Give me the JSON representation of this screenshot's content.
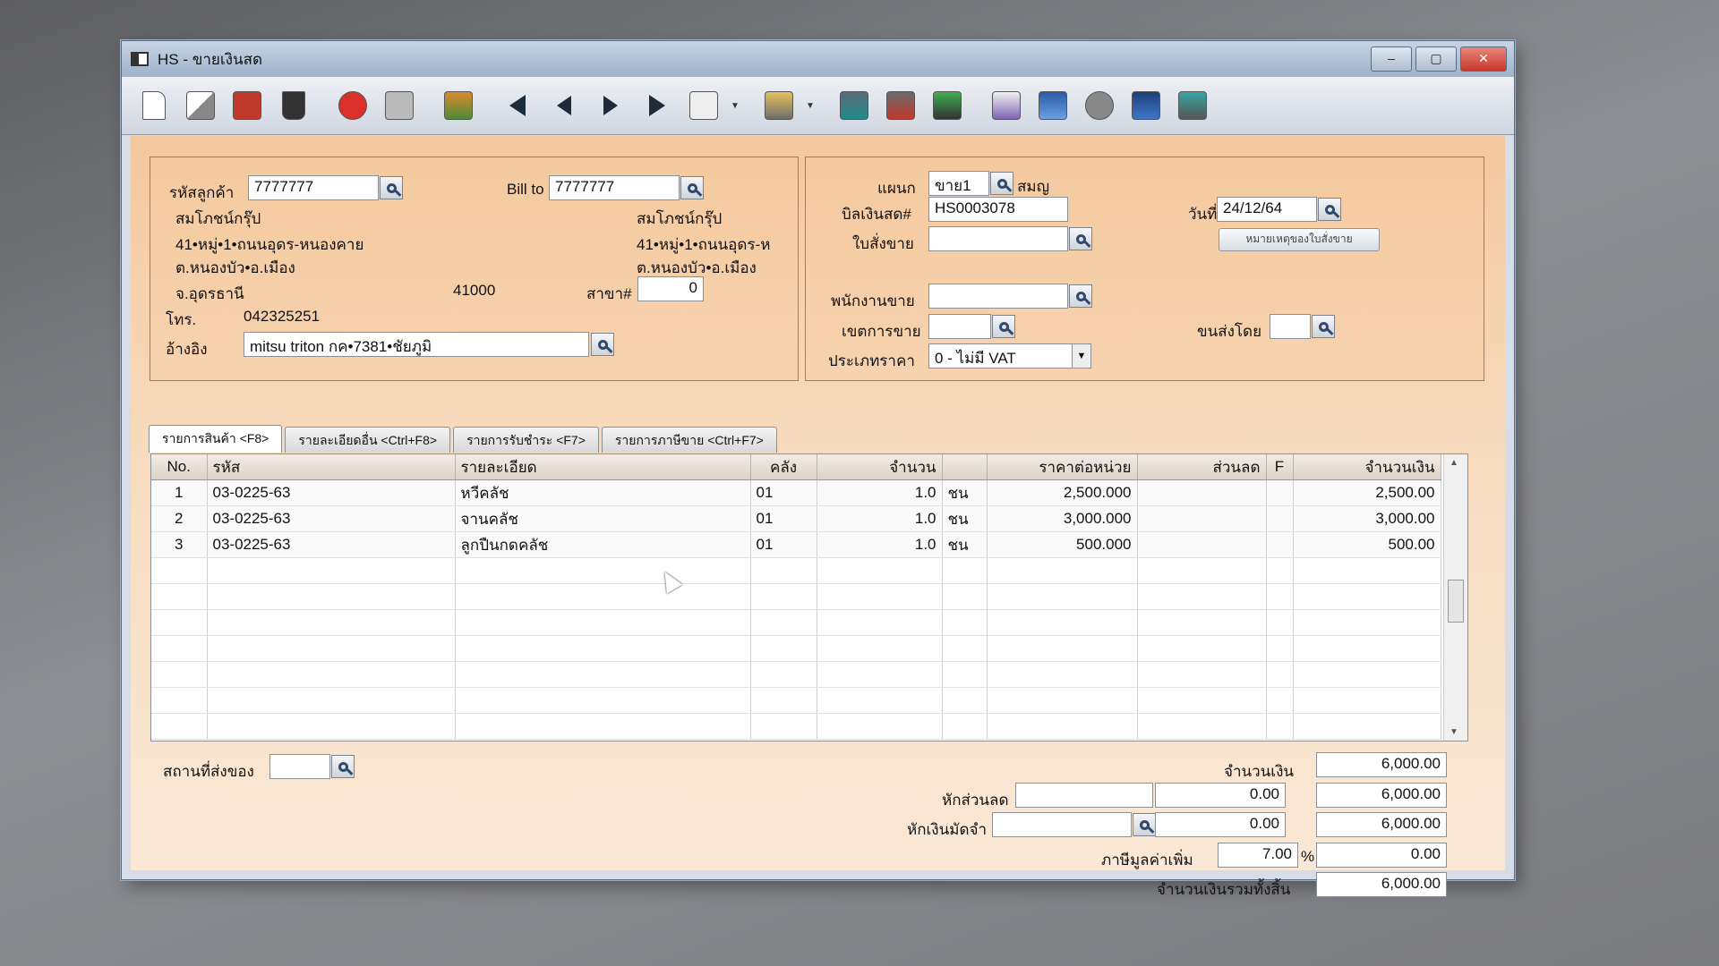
{
  "window": {
    "title": "HS - ขายเงินสด",
    "controls": {
      "minimize": "–",
      "maximize": "▢",
      "close": "✕"
    }
  },
  "toolbar": {
    "icons": [
      "new-doc-icon",
      "edit-icon",
      "void-icon",
      "trash-icon",
      "cancel-icon",
      "save-icon",
      "books-icon",
      "first-record-icon",
      "prev-record-icon",
      "next-record-icon",
      "last-record-icon",
      "search-doc-icon",
      "print-icon",
      "report1-icon",
      "report2-icon",
      "sv-icon",
      "rebill-icon",
      "ok-down-icon",
      "link-icon",
      "ok-icon",
      "export-icon"
    ]
  },
  "customer": {
    "code_label": "รหัสลูกค้า",
    "code_value": "7777777",
    "bill_to_label": "Bill to",
    "bill_to_value": "7777777",
    "name": "สมโภชน์กรุ๊ป",
    "address1": "41•หมู่•1•ถนนอุดร-หนองคาย",
    "address2": "ต.หนองบัว•อ.เมือง",
    "province": "จ.อุดรธานี",
    "postcode": "41000",
    "phone_label": "โทร.",
    "phone": "042325251",
    "reference_label": "อ้างอิง",
    "reference_value": "mitsu triton กค•7381•ชัยภูมิ",
    "billto_name": "สมโภชน์กรุ๊ป",
    "billto_address1": "41•หมู่•1•ถนนอุดร-ห",
    "billto_address2": "ต.หนองบัว•อ.เมือง",
    "branch_label": "สาขา#",
    "branch_value": "0"
  },
  "doc": {
    "dept_label": "แผนก",
    "dept_value": "ขาย1",
    "dept_name": "สมญ",
    "bill_label": "บิลเงินสด#",
    "bill_value": "HS0003078",
    "date_label": "วันที่",
    "date_value": "24/12/64",
    "order_label": "ใบสั่งขาย",
    "order_note_button": "หมายเหตุของใบสั่งขาย",
    "sales_label": "พนักงานขาย",
    "area_label": "เขตการขาย",
    "ship_by_label": "ขนส่งโดย",
    "price_type_label": "ประเภทราคา",
    "price_type_value": "0 - ไม่มี VAT"
  },
  "tabs": [
    "รายการสินค้า <F8>",
    "รายละเอียดอื่น <Ctrl+F8>",
    "รายการรับชำระ <F7>",
    "รายการภาษีขาย <Ctrl+F7>"
  ],
  "grid": {
    "headers": [
      "No.",
      "รหัส",
      "รายละเอียด",
      "คลัง",
      "จำนวน",
      "",
      "ราคาต่อหน่วย",
      "ส่วนลด",
      "F",
      "จำนวนเงิน"
    ],
    "rows": [
      [
        "1",
        "03-0225-63",
        "หวีคลัช",
        "01",
        "1.0",
        "ชน",
        "2,500.000",
        "",
        "",
        "2,500.00"
      ],
      [
        "2",
        "03-0225-63",
        "จานคลัช",
        "01",
        "1.0",
        "ชน",
        "3,000.000",
        "",
        "",
        "3,000.00"
      ],
      [
        "3",
        "03-0225-63",
        "ลูกปืนกดคลัช",
        "01",
        "1.0",
        "ชน",
        "500.000",
        "",
        "",
        "500.00"
      ]
    ]
  },
  "footer": {
    "ship_place_label": "สถานที่ส่งของ",
    "amount_label": "จำนวนเงิน",
    "amount_value": "6,000.00",
    "discount_label": "หักส่วนลด",
    "discount_value": "0.00",
    "discount_total": "6,000.00",
    "deposit_label": "หักเงินมัดจำ",
    "deposit_value": "0.00",
    "deposit_total": "6,000.00",
    "vat_label": "ภาษีมูลค่าเพิ่ม",
    "vat_rate": "7.00",
    "vat_pct": "%",
    "vat_value": "0.00",
    "grand_label": "จำนวนเงินรวมทั้งสิ้น",
    "grand_value": "6,000.00"
  }
}
